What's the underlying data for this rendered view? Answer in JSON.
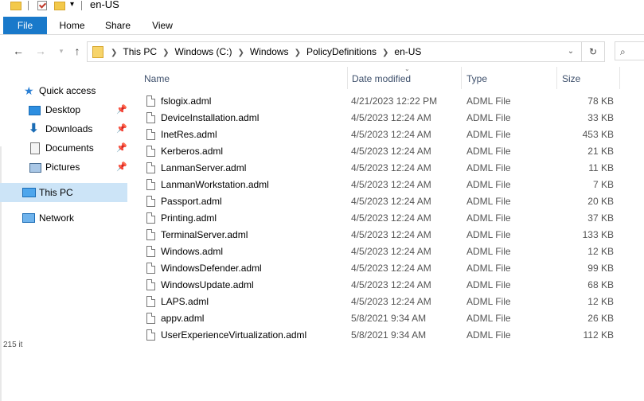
{
  "window": {
    "title": "en-US"
  },
  "ribbon": {
    "tabs": [
      "File",
      "Home",
      "Share",
      "View"
    ]
  },
  "address": {
    "crumbs": [
      "This PC",
      "Windows (C:)",
      "Windows",
      "PolicyDefinitions",
      "en-US"
    ]
  },
  "nav": {
    "quick_access": "Quick access",
    "desktop": "Desktop",
    "downloads": "Downloads",
    "documents": "Documents",
    "pictures": "Pictures",
    "this_pc": "This PC",
    "network": "Network"
  },
  "columns": {
    "name": "Name",
    "date": "Date modified",
    "type": "Type",
    "size": "Size"
  },
  "files": [
    {
      "name": "fslogix.adml",
      "date": "4/21/2023 12:22 PM",
      "type": "ADML File",
      "size": "78 KB"
    },
    {
      "name": "DeviceInstallation.adml",
      "date": "4/5/2023 12:24 AM",
      "type": "ADML File",
      "size": "33 KB"
    },
    {
      "name": "InetRes.adml",
      "date": "4/5/2023 12:24 AM",
      "type": "ADML File",
      "size": "453 KB"
    },
    {
      "name": "Kerberos.adml",
      "date": "4/5/2023 12:24 AM",
      "type": "ADML File",
      "size": "21 KB"
    },
    {
      "name": "LanmanServer.adml",
      "date": "4/5/2023 12:24 AM",
      "type": "ADML File",
      "size": "11 KB"
    },
    {
      "name": "LanmanWorkstation.adml",
      "date": "4/5/2023 12:24 AM",
      "type": "ADML File",
      "size": "7 KB"
    },
    {
      "name": "Passport.adml",
      "date": "4/5/2023 12:24 AM",
      "type": "ADML File",
      "size": "20 KB"
    },
    {
      "name": "Printing.adml",
      "date": "4/5/2023 12:24 AM",
      "type": "ADML File",
      "size": "37 KB"
    },
    {
      "name": "TerminalServer.adml",
      "date": "4/5/2023 12:24 AM",
      "type": "ADML File",
      "size": "133 KB"
    },
    {
      "name": "Windows.adml",
      "date": "4/5/2023 12:24 AM",
      "type": "ADML File",
      "size": "12 KB"
    },
    {
      "name": "WindowsDefender.adml",
      "date": "4/5/2023 12:24 AM",
      "type": "ADML File",
      "size": "99 KB"
    },
    {
      "name": "WindowsUpdate.adml",
      "date": "4/5/2023 12:24 AM",
      "type": "ADML File",
      "size": "68 KB"
    },
    {
      "name": "LAPS.adml",
      "date": "4/5/2023 12:24 AM",
      "type": "ADML File",
      "size": "12 KB"
    },
    {
      "name": "appv.adml",
      "date": "5/8/2021 9:34 AM",
      "type": "ADML File",
      "size": "26 KB"
    },
    {
      "name": "UserExperienceVirtualization.adml",
      "date": "5/8/2021 9:34 AM",
      "type": "ADML File",
      "size": "112 KB"
    }
  ],
  "status": {
    "items": "215 it"
  }
}
